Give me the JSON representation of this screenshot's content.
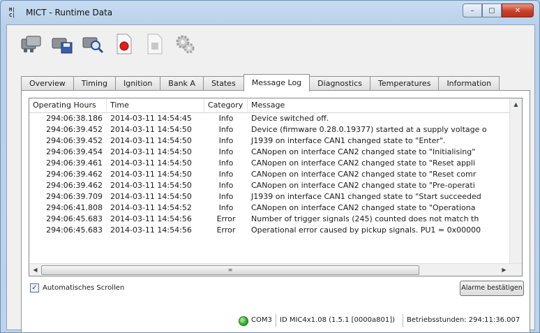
{
  "window": {
    "app_icon_text": "MICT",
    "title": "MICT - Runtime Data",
    "buttons": {
      "minimize": "–",
      "maximize": "▢",
      "close": "✕"
    }
  },
  "toolbar": {
    "buttons": [
      {
        "icon": "read-engines-icon"
      },
      {
        "icon": "save-disk-icon"
      },
      {
        "icon": "search-icon"
      },
      {
        "icon": "record-icon"
      },
      {
        "icon": "stop-icon"
      },
      {
        "icon": "settings-gear-icon"
      }
    ]
  },
  "tabs": [
    {
      "label": "Overview",
      "active": false
    },
    {
      "label": "Timing",
      "active": false
    },
    {
      "label": "Ignition",
      "active": false
    },
    {
      "label": "Bank A",
      "active": false
    },
    {
      "label": "States",
      "active": false
    },
    {
      "label": "Message Log",
      "active": true
    },
    {
      "label": "Diagnostics",
      "active": false
    },
    {
      "label": "Temperatures",
      "active": false
    },
    {
      "label": "Information",
      "active": false
    }
  ],
  "log": {
    "columns": [
      "Operating Hours",
      "Time",
      "Category",
      "Message"
    ],
    "rows": [
      [
        "294:06:38.186",
        "2014-03-11  14:54:45",
        "Info",
        "Device switched off."
      ],
      [
        "294:06:39.452",
        "2014-03-11  14:54:50",
        "Info",
        "Device (firmware 0.28.0.19377) started at a supply voltage o"
      ],
      [
        "294:06:39.452",
        "2014-03-11  14:54:50",
        "Info",
        "J1939 on interface CAN1 changed state to \"Enter\"."
      ],
      [
        "294:06:39.454",
        "2014-03-11  14:54:50",
        "Info",
        "CANopen on interface CAN2 changed state to \"Initialising\""
      ],
      [
        "294:06:39.461",
        "2014-03-11  14:54:50",
        "Info",
        "CANopen on interface CAN2 changed state to \"Reset appli"
      ],
      [
        "294:06:39.462",
        "2014-03-11  14:54:50",
        "Info",
        "CANopen on interface CAN2 changed state to \"Reset comr"
      ],
      [
        "294:06:39.462",
        "2014-03-11  14:54:50",
        "Info",
        "CANopen on interface CAN2 changed state to \"Pre-operati"
      ],
      [
        "294:06:39.709",
        "2014-03-11  14:54:50",
        "Info",
        "J1939 on interface CAN1 changed state to \"Start succeeded"
      ],
      [
        "294:06:41.808",
        "2014-03-11  14:54:52",
        "Info",
        "CANopen on interface CAN2 changed state to \"Operationa"
      ],
      [
        "294:06:45.683",
        "2014-03-11  14:54:56",
        "Error",
        "Number of trigger signals (245) counted does not match th"
      ],
      [
        "294:06:45.683",
        "2014-03-11  14:54:56",
        "Error",
        "Operational error caused by pickup signals. PU1 = 0x00000"
      ]
    ]
  },
  "autoscroll": {
    "label": "Automatisches Scrollen",
    "checked": true
  },
  "ack_button": "Alarme bestätigen",
  "status": {
    "port": "COM3",
    "device_id": "ID MIC4x1.08 (1.5.1 [0000a801])",
    "runtime": "Betriebsstunden: 294:11:36.007",
    "led_color": "#2fb42a"
  }
}
